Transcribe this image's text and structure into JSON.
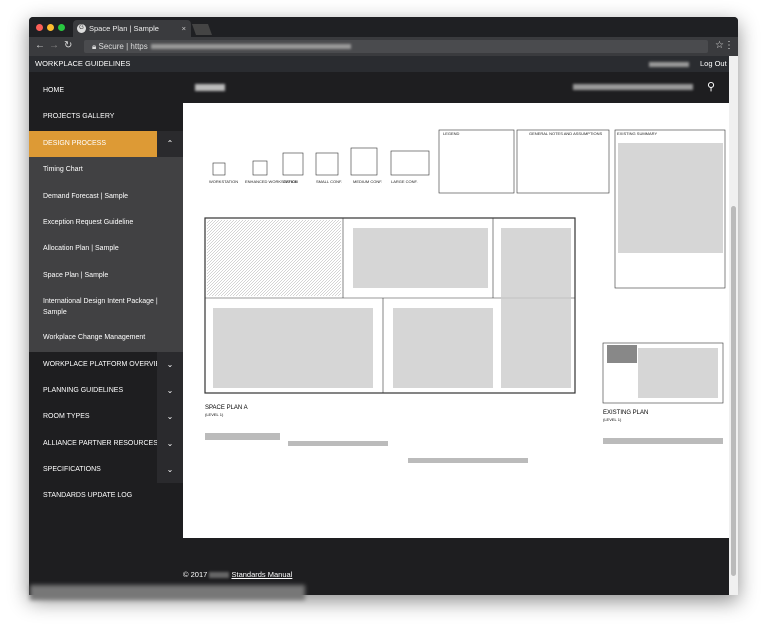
{
  "browser": {
    "tab_title": "Space Plan | Sample",
    "tab_favicon": "G",
    "secure_label": "Secure",
    "url_prefix": "https"
  },
  "topnav": {
    "brand": "WORKPLACE GUIDELINES",
    "logout": "Log Out"
  },
  "sidebar": {
    "items": [
      {
        "label": "HOME"
      },
      {
        "label": "PROJECTS GALLERY"
      },
      {
        "label": "DESIGN PROCESS",
        "expanded": true,
        "children": [
          "Timing Chart",
          "Demand Forecast | Sample",
          "Exception Request Guideline",
          "Allocation Plan | Sample",
          "Space Plan | Sample",
          "International Design Intent Package | Sample",
          "Workplace Change Management"
        ]
      },
      {
        "label": "WORKPLACE PLATFORM OVERVIEW"
      },
      {
        "label": "PLANNING GUIDELINES"
      },
      {
        "label": "ROOM TYPES"
      },
      {
        "label": "ALLIANCE PARTNER RESOURCES"
      },
      {
        "label": "SPECIFICATIONS"
      },
      {
        "label": "STANDARDS UPDATE LOG"
      }
    ],
    "active": "Space Plan | Sample"
  },
  "drawing": {
    "room_types": [
      "WORKSTATION",
      "ENHANCED WORKSTATION",
      "OFFICE",
      "SMALL CONF.",
      "MEDIUM CONF.",
      "LARGE CONF."
    ],
    "legend_title": "LEGEND",
    "notes_title": "GENERAL NOTES AND ASSUMPTIONS",
    "summary_title": "EXISTING SUMMARY",
    "plan_a_title": "SPACE PLAN A",
    "plan_a_level": "(LEVEL 1)",
    "existing_title": "EXISTING PLAN",
    "existing_level": "(LEVEL 1)"
  },
  "footer": {
    "copyright": "© 2017",
    "link": "Standards Manual"
  },
  "colors": {
    "accent": "#dd9a35",
    "sidebar": "#1e1e20",
    "submenu": "#414143"
  }
}
